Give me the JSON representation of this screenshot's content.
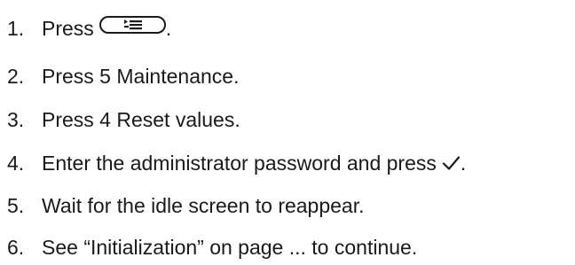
{
  "steps": [
    {
      "number": "1.",
      "text_before": "Press",
      "icon": "menu-key-icon",
      "text_after": "."
    },
    {
      "number": "2.",
      "text": "Press 5 Maintenance."
    },
    {
      "number": "3.",
      "text": "Press 4 Reset values."
    },
    {
      "number": "4.",
      "text_before": "Enter the administrator password and press",
      "icon": "checkmark-icon",
      "text_after": "."
    },
    {
      "number": "5.",
      "text": "Wait for the idle screen to reappear."
    },
    {
      "number": "6.",
      "text": "See “Initialization” on page ... to continue."
    }
  ]
}
